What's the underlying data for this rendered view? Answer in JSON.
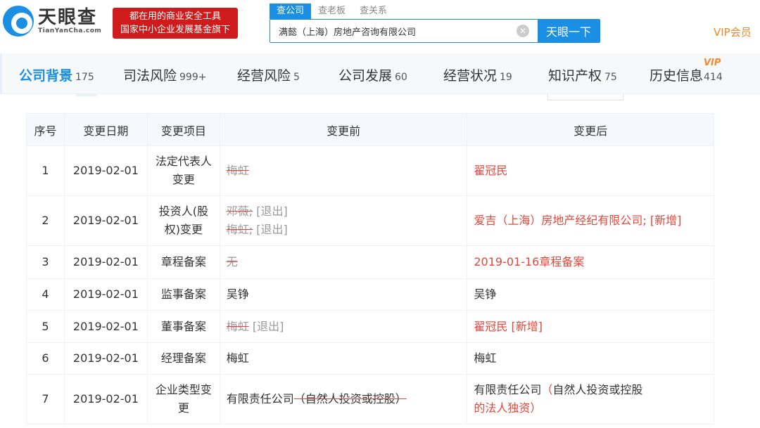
{
  "header": {
    "logo_cn": "天眼查",
    "logo_en": "TianYanCha.com",
    "slogan_line1": "都在用的商业安全工具",
    "slogan_line2": "国家中小企业发展基金旗下",
    "search_tabs": [
      "查公司",
      "查老板",
      "查关系"
    ],
    "search_value": "满懿（上海）房地产咨询有限公司",
    "search_button": "天眼一下",
    "vip_link": "VIP会员"
  },
  "nav": {
    "items": [
      {
        "label": "公司背景",
        "count": "175"
      },
      {
        "label": "司法风险",
        "count": "999+"
      },
      {
        "label": "经营风险",
        "count": "5"
      },
      {
        "label": "公司发展",
        "count": "60"
      },
      {
        "label": "经营状况",
        "count": "19"
      },
      {
        "label": "知识产权",
        "count": "75"
      },
      {
        "label": "历史信息",
        "count": "414"
      }
    ],
    "vip_badge": "VIP"
  },
  "colors": {
    "accent": "#1a8fe3",
    "added": "#e2473a",
    "vip": "#f08a2e"
  },
  "table": {
    "headers": [
      "序号",
      "变更日期",
      "变更项目",
      "变更前",
      "变更后"
    ],
    "rows": [
      {
        "no": "1",
        "date": "2019-02-01",
        "item": "法定代表人变更",
        "before": [
          [
            {
              "t": "梅虹",
              "s": "del"
            }
          ]
        ],
        "after": [
          [
            {
              "t": "翟冠民",
              "s": "add"
            }
          ]
        ]
      },
      {
        "no": "2",
        "date": "2019-02-01",
        "item": "投资人(股权)变更",
        "before": [
          [
            {
              "t": "邓薇;",
              "s": "del"
            },
            {
              "t": " [退出]",
              "s": "tag"
            }
          ],
          [
            {
              "t": "梅虹;",
              "s": "del"
            },
            {
              "t": " [退出]",
              "s": "tag"
            }
          ]
        ],
        "after": [
          [
            {
              "t": "爱吉（上海）房地产经纪有限公司; [新增]",
              "s": "add"
            }
          ]
        ]
      },
      {
        "no": "3",
        "date": "2019-02-01",
        "item": "章程备案",
        "before": [
          [
            {
              "t": "无",
              "s": "del"
            }
          ]
        ],
        "after": [
          [
            {
              "t": "2019-01-16章程备案",
              "s": "add"
            }
          ]
        ]
      },
      {
        "no": "4",
        "date": "2019-02-01",
        "item": "监事备案",
        "before": [
          [
            {
              "t": "吴铮",
              "s": "plain"
            }
          ]
        ],
        "after": [
          [
            {
              "t": "吴铮",
              "s": "plain"
            }
          ]
        ]
      },
      {
        "no": "5",
        "date": "2019-02-01",
        "item": "董事备案",
        "before": [
          [
            {
              "t": "梅虹",
              "s": "del"
            },
            {
              "t": " [退出]",
              "s": "tag"
            }
          ]
        ],
        "after": [
          [
            {
              "t": "翟冠民 [新增]",
              "s": "add"
            }
          ]
        ]
      },
      {
        "no": "6",
        "date": "2019-02-01",
        "item": "经理备案",
        "before": [
          [
            {
              "t": "梅虹",
              "s": "plain"
            }
          ]
        ],
        "after": [
          [
            {
              "t": "梅虹",
              "s": "plain"
            }
          ]
        ]
      },
      {
        "no": "7",
        "date": "2019-02-01",
        "item": "企业类型变更",
        "before": [
          [
            {
              "t": "有限责任公司",
              "s": "plain"
            },
            {
              "t": "（自然人投资或控股）",
              "s": "dk"
            }
          ]
        ],
        "after": [
          [
            {
              "t": "有限责任公司",
              "s": "plain"
            },
            {
              "t": "（",
              "s": "add"
            },
            {
              "t": "自然人投资或控股",
              "s": "plain"
            },
            {
              "t": "的法人独资）",
              "s": "add"
            }
          ]
        ]
      }
    ]
  }
}
